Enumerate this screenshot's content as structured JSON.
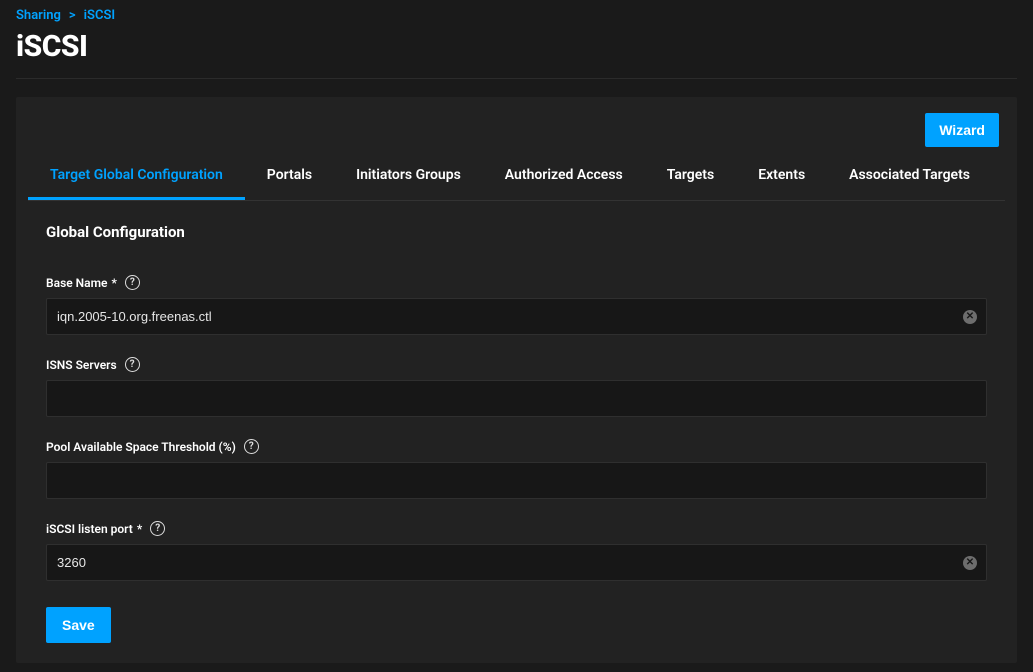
{
  "breadcrumb": {
    "parent": "Sharing",
    "current": "iSCSI"
  },
  "page_title": "iSCSI",
  "wizard_button": "Wizard",
  "tabs": [
    {
      "label": "Target Global Configuration",
      "active": true
    },
    {
      "label": "Portals",
      "active": false
    },
    {
      "label": "Initiators Groups",
      "active": false
    },
    {
      "label": "Authorized Access",
      "active": false
    },
    {
      "label": "Targets",
      "active": false
    },
    {
      "label": "Extents",
      "active": false
    },
    {
      "label": "Associated Targets",
      "active": false
    }
  ],
  "section_title": "Global Configuration",
  "fields": {
    "base_name": {
      "label": "Base Name",
      "required": "*",
      "value": "iqn.2005-10.org.freenas.ctl",
      "has_clear": true
    },
    "isns_servers": {
      "label": "ISNS Servers",
      "value": "",
      "has_clear": false
    },
    "pool_threshold": {
      "label": "Pool Available Space Threshold (%)",
      "value": "",
      "has_clear": false
    },
    "listen_port": {
      "label": "iSCSI listen port",
      "required": "*",
      "value": "3260",
      "has_clear": true
    }
  },
  "save_button": "Save"
}
